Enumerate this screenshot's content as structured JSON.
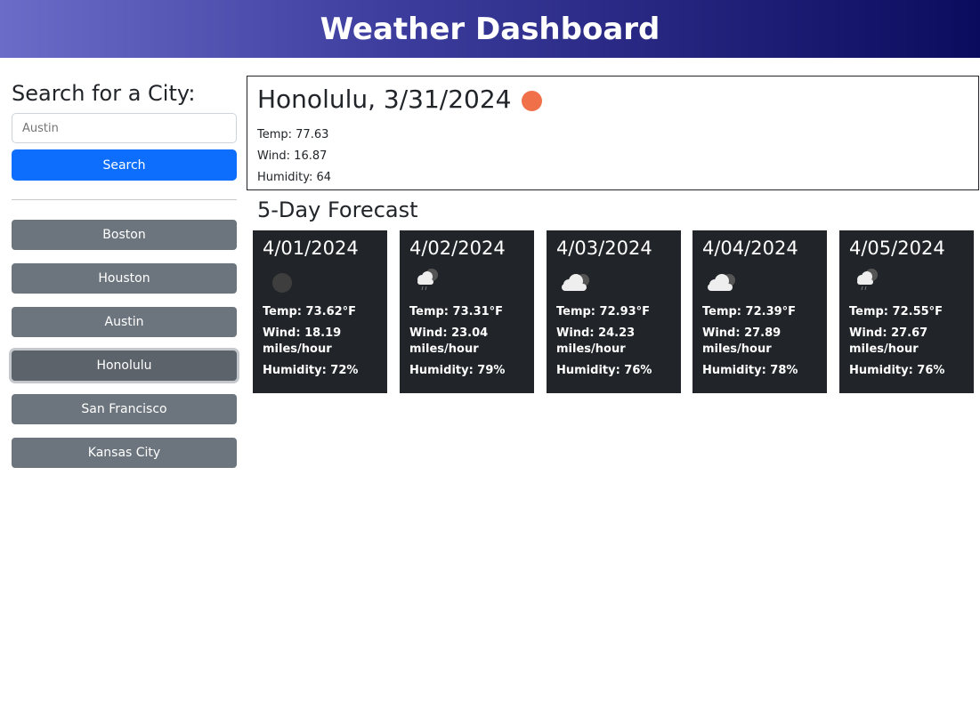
{
  "header": {
    "title": "Weather Dashboard"
  },
  "sidebar": {
    "heading": "Search for a City:",
    "search_placeholder": "Austin",
    "search_button": "Search",
    "cities": [
      {
        "label": "Boston",
        "active": false
      },
      {
        "label": "Houston",
        "active": false
      },
      {
        "label": "Austin",
        "active": false
      },
      {
        "label": "Honolulu",
        "active": true
      },
      {
        "label": "San Francisco",
        "active": false
      },
      {
        "label": "Kansas City",
        "active": false
      }
    ]
  },
  "current": {
    "title": "Honolulu, 3/31/2024",
    "icon": "sun-icon",
    "icon_color": "#f0704a",
    "temp": "Temp: 77.63",
    "wind": "Wind: 16.87",
    "humidity": "Humidity: 64"
  },
  "forecast": {
    "heading": "5-Day Forecast",
    "days": [
      {
        "date": "4/01/2024",
        "icon": "dark-sun-icon",
        "temp": "Temp: 73.62°F",
        "wind": "Wind: 18.19 miles/hour",
        "humidity": "Humidity: 72%"
      },
      {
        "date": "4/02/2024",
        "icon": "rain-cloud-icon",
        "temp": "Temp: 73.31°F",
        "wind": "Wind: 23.04 miles/hour",
        "humidity": "Humidity: 79%"
      },
      {
        "date": "4/03/2024",
        "icon": "cloud-icon",
        "temp": "Temp: 72.93°F",
        "wind": "Wind: 24.23 miles/hour",
        "humidity": "Humidity: 76%"
      },
      {
        "date": "4/04/2024",
        "icon": "cloud-icon",
        "temp": "Temp: 72.39°F",
        "wind": "Wind: 27.89 miles/hour",
        "humidity": "Humidity: 78%"
      },
      {
        "date": "4/05/2024",
        "icon": "rain-cloud-icon",
        "temp": "Temp: 72.55°F",
        "wind": "Wind: 27.67 miles/hour",
        "humidity": "Humidity: 76%"
      }
    ]
  },
  "colors": {
    "primary": "#0d6efd",
    "secondary": "#6c757d",
    "card_bg": "#212529"
  }
}
